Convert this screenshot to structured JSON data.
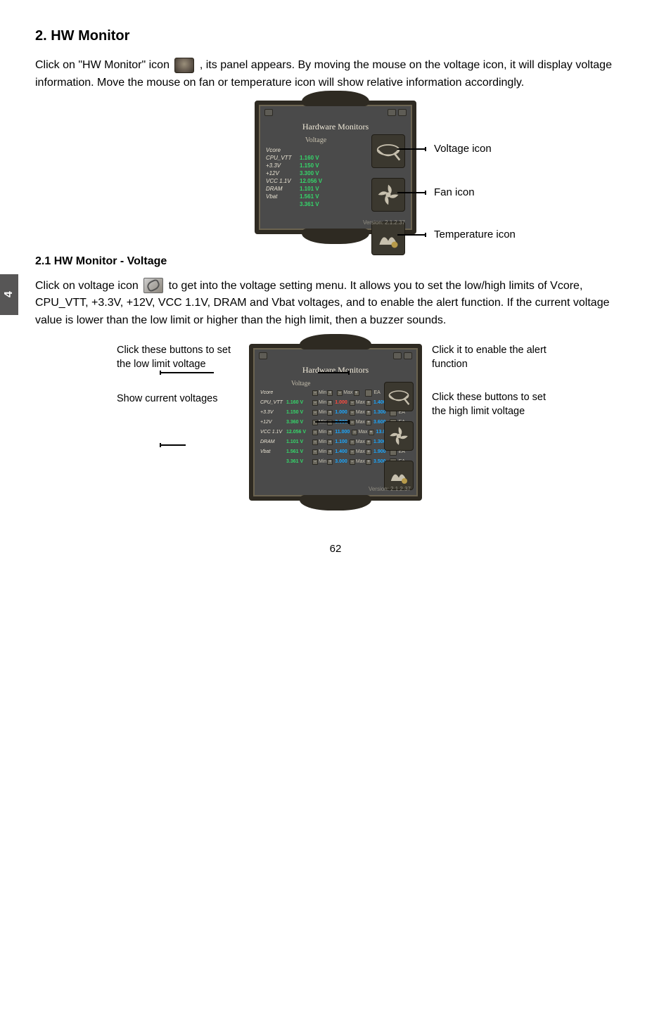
{
  "chapter_tab": "4",
  "page_number": "62",
  "heading": "2. HW Monitor",
  "para1_a": "Click on \"HW Monitor\" icon ",
  "para1_b": ", its panel appears. By moving the mouse on the voltage icon, it will display voltage information. Move the mouse on fan or temperature icon will show relative information accordingly.",
  "fig1": {
    "title": "Hardware Monitors",
    "subtitle": "Voltage",
    "version": "Version: 2.1.2.37",
    "rows": [
      {
        "label": "Vcore",
        "value": ""
      },
      {
        "label": "CPU_VTT",
        "value": "1.160 V"
      },
      {
        "label": "+3.3V",
        "value": "1.150 V"
      },
      {
        "label": "+12V",
        "value": "3.300 V"
      },
      {
        "label": "VCC 1.1V",
        "value": "12.056 V"
      },
      {
        "label": "DRAM",
        "value": "1.101 V"
      },
      {
        "label": "Vbat",
        "value": "1.561 V"
      },
      {
        "label": "",
        "value": "3.361 V"
      }
    ],
    "anno_voltage": "Voltage icon",
    "anno_fan": "Fan icon",
    "anno_temp": "Temperature icon"
  },
  "subheading": "2.1 HW Monitor - Voltage",
  "para2_a": "Click on voltage icon ",
  "para2_b": " to get into the voltage setting menu. It allows you to set the low/high limits of Vcore, CPU_VTT, +3.3V, +12V, VCC 1.1V, DRAM and Vbat voltages, and to enable the alert function. If the current voltage value is lower than the low limit or higher than the high limit, then a buzzer sounds.",
  "callouts": {
    "left1": "Click these buttons to set the low limit voltage",
    "left2": "Show current voltages",
    "right1": "Click it to enable the alert function",
    "right2": "Click these buttons to set the high limit voltage"
  },
  "fig2": {
    "title": "Hardware Monitors",
    "subtitle": "Voltage",
    "version": "Version: 2.1.2.37",
    "min_label": "Min",
    "max_label": "Max",
    "ea_label": "EA",
    "rows": [
      {
        "label": "Vcore",
        "current": "",
        "min": "",
        "max": "",
        "min_red": false
      },
      {
        "label": "CPU_VTT",
        "current": "1.160 V",
        "min": "1.000",
        "max": "1.400",
        "min_red": true
      },
      {
        "label": "+3.3V",
        "current": "1.150 V",
        "min": "1.000",
        "max": "1.300",
        "min_red": false
      },
      {
        "label": "+12V",
        "current": "3.360 V",
        "min": "3.000",
        "max": "3.600",
        "min_red": false
      },
      {
        "label": "VCC 1.1V",
        "current": "12.056 V",
        "min": "11.000",
        "max": "13.000",
        "min_red": false
      },
      {
        "label": "DRAM",
        "current": "1.101 V",
        "min": "1.100",
        "max": "1.300",
        "min_red": false
      },
      {
        "label": "Vbat",
        "current": "1.561 V",
        "min": "1.400",
        "max": "1.900",
        "min_red": false
      },
      {
        "label": "",
        "current": "3.361 V",
        "min": "3.000",
        "max": "3.500",
        "min_red": false
      }
    ]
  }
}
